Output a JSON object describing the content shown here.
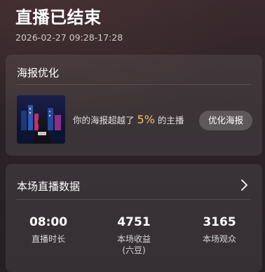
{
  "header": {
    "title": "直播已结束",
    "time_range": "2026-02-27 09:28-17:28"
  },
  "poster_card": {
    "title": "海报优化",
    "rank_prefix": "你的海报超越了",
    "rank_percent": "5%",
    "rank_suffix": "的主播",
    "optimize_button": "优化海报"
  },
  "stats_card": {
    "title": "本场直播数据",
    "stats": [
      {
        "value": "08:00",
        "label": "直播时长"
      },
      {
        "value": "4751",
        "label": "本场收益\n(六豆)"
      },
      {
        "value": "3165",
        "label": "本场观众"
      }
    ]
  },
  "colors": {
    "highlight": "#f3c066",
    "card_bg": "rgba(255,255,255,0.08)"
  },
  "icons": {
    "chevron": "chevron-right-icon"
  }
}
